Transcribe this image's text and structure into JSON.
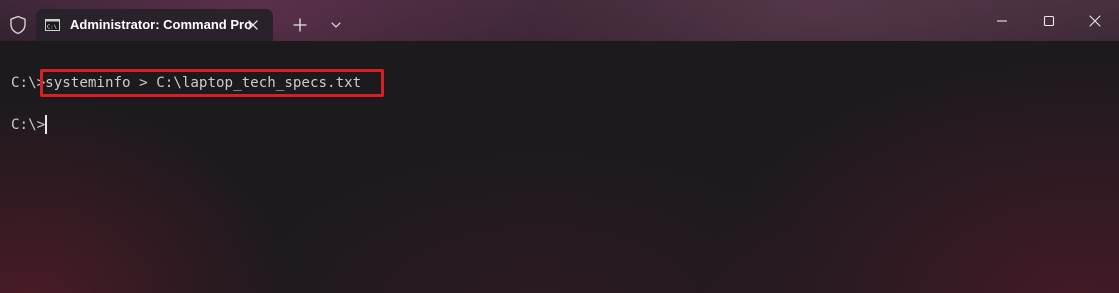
{
  "window": {
    "tab_title": "Administrator: Command Pro",
    "icons": {
      "shield": "shield-icon",
      "tab": "command-prompt-icon",
      "tab_close": "close-icon",
      "new_tab": "plus-icon",
      "dropdown": "chevron-down-icon",
      "minimize": "minimize-icon",
      "maximize": "maximize-icon",
      "close": "close-icon"
    }
  },
  "terminal": {
    "line1_prompt": "C:\\>",
    "line1_command": "systeminfo > C:\\laptop_tech_specs.txt",
    "line2_prompt": "C:\\>"
  },
  "colors": {
    "highlight": "#d91f26",
    "text": "#cccccc",
    "tab_bg": "#29222a"
  }
}
